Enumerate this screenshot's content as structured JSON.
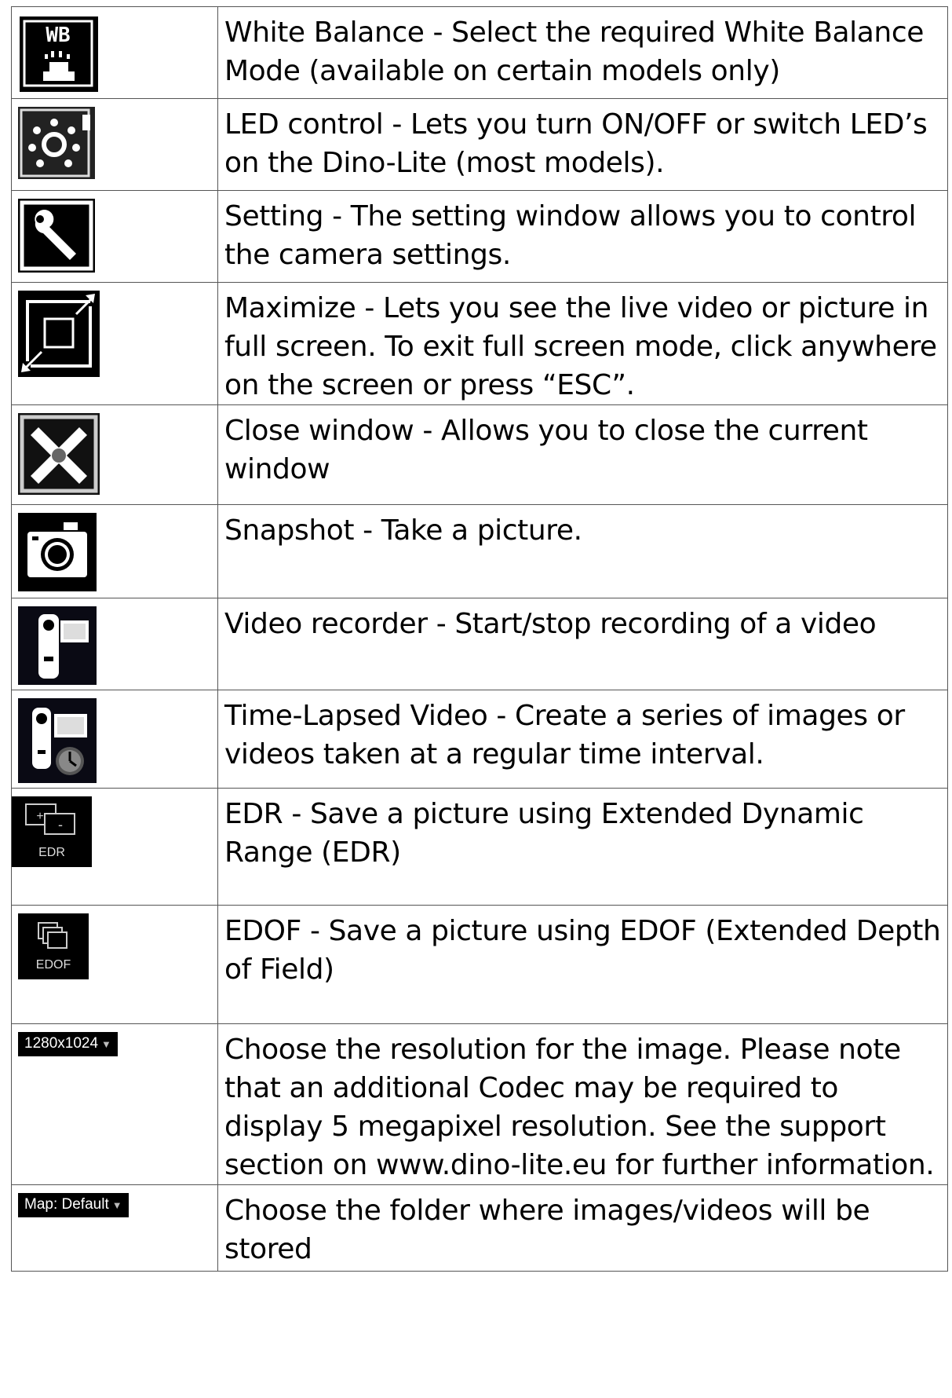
{
  "rows": [
    {
      "icon": "white-balance-icon",
      "icon_text": "WB",
      "text": "White Balance - Select the required White Balance Mode (available on certain models only)"
    },
    {
      "icon": "led-control-icon",
      "text": "LED control - Lets you turn ON/OFF or switch LED’s on the Dino-Lite (most models)."
    },
    {
      "icon": "wrench-icon",
      "text": "Setting - The setting window allows you to control the camera settings."
    },
    {
      "icon": "maximize-icon",
      "text": "Maximize - Lets you see the live video or picture in full screen. To exit full screen mode, click anywhere on the screen or press “ESC”."
    },
    {
      "icon": "close-window-icon",
      "text": "Close window - Allows you to close the current window"
    },
    {
      "icon": "camera-icon",
      "text": "Snapshot - Take a picture."
    },
    {
      "icon": "video-recorder-icon",
      "text": "Video recorder - Start/stop recording of a video"
    },
    {
      "icon": "time-lapse-icon",
      "text": "Time-Lapsed Video - Create a series of images or videos taken at a regular time interval."
    },
    {
      "icon": "edr-icon",
      "icon_text": "EDR",
      "text": "EDR - Save a picture using Extended Dynamic Range (EDR)"
    },
    {
      "icon": "edof-icon",
      "icon_text": "EDOF",
      "text": "EDOF - Save a picture using EDOF (Extended Depth of Field)"
    },
    {
      "icon": "resolution-dropdown",
      "icon_text": "1280x1024",
      "text": "Choose the resolution for the image. Please note that an additional Codec may be required to display 5 megapixel resolution. See the support section on www.dino-lite.eu for further information."
    },
    {
      "icon": "folder-map-dropdown",
      "icon_text": "Map: Default",
      "text": "Choose the folder where images/videos will be stored"
    }
  ]
}
